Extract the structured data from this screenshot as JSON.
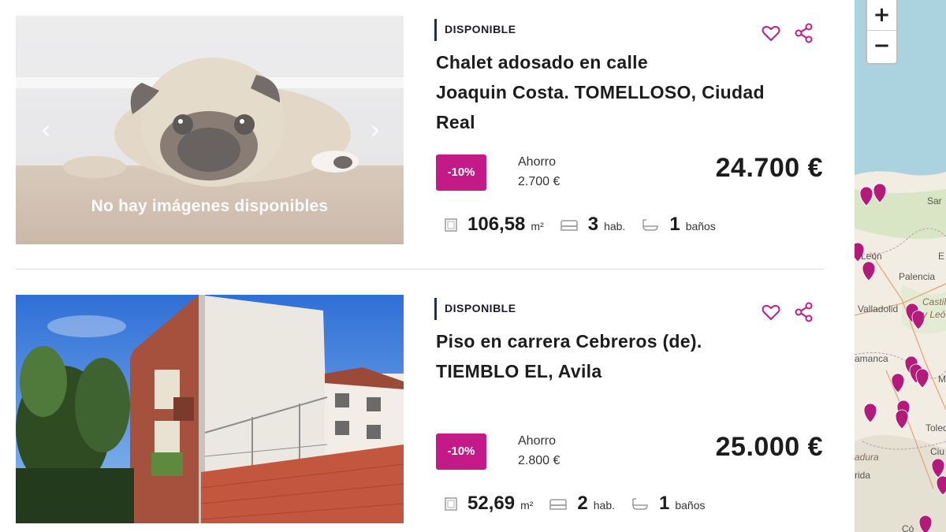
{
  "listings": [
    {
      "status": "DISPONIBLE",
      "title_lines": [
        "Chalet adosado en calle",
        "Joaquin Costa. TOMELLOSO, Ciudad",
        "Real"
      ],
      "photo_caption": "No hay imágenes disponibles",
      "discount": "-10%",
      "savings_label": "Ahorro",
      "savings_value": "2.700 €",
      "price": "24.700 €",
      "area_value": "106,58",
      "area_unit": "m²",
      "rooms_value": "3",
      "rooms_unit": "hab.",
      "baths_value": "1",
      "baths_unit": "baños",
      "icons": [
        "heart-icon",
        "share-icon",
        "area-icon",
        "bed-icon",
        "bath-icon",
        "chevron-left-icon",
        "chevron-right-icon"
      ]
    },
    {
      "status": "DISPONIBLE",
      "title_lines": [
        "Piso en carrera Cebreros (de).",
        "TIEMBLO EL, Avila"
      ],
      "discount": "-10%",
      "savings_label": "Ahorro",
      "savings_value": "2.800 €",
      "price": "25.000 €",
      "area_value": "52,69",
      "area_unit": "m²",
      "rooms_value": "2",
      "rooms_unit": "hab.",
      "baths_value": "1",
      "baths_unit": "baños",
      "icons": [
        "heart-icon",
        "share-icon",
        "area-icon",
        "bed-icon",
        "bath-icon"
      ]
    }
  ],
  "map": {
    "zoom_in": "+",
    "zoom_out": "−",
    "labels": [
      "Sar",
      "León",
      "E",
      "Palencia",
      "Valladolid",
      "Castil",
      "y Leó",
      "amanca",
      "M",
      "Toledo",
      "Ciu",
      "adura",
      "rida",
      "Có"
    ],
    "marker_color": "#b5197a"
  },
  "colors": {
    "accent": "#c41a87",
    "status_bar": "#1d2a7a"
  }
}
